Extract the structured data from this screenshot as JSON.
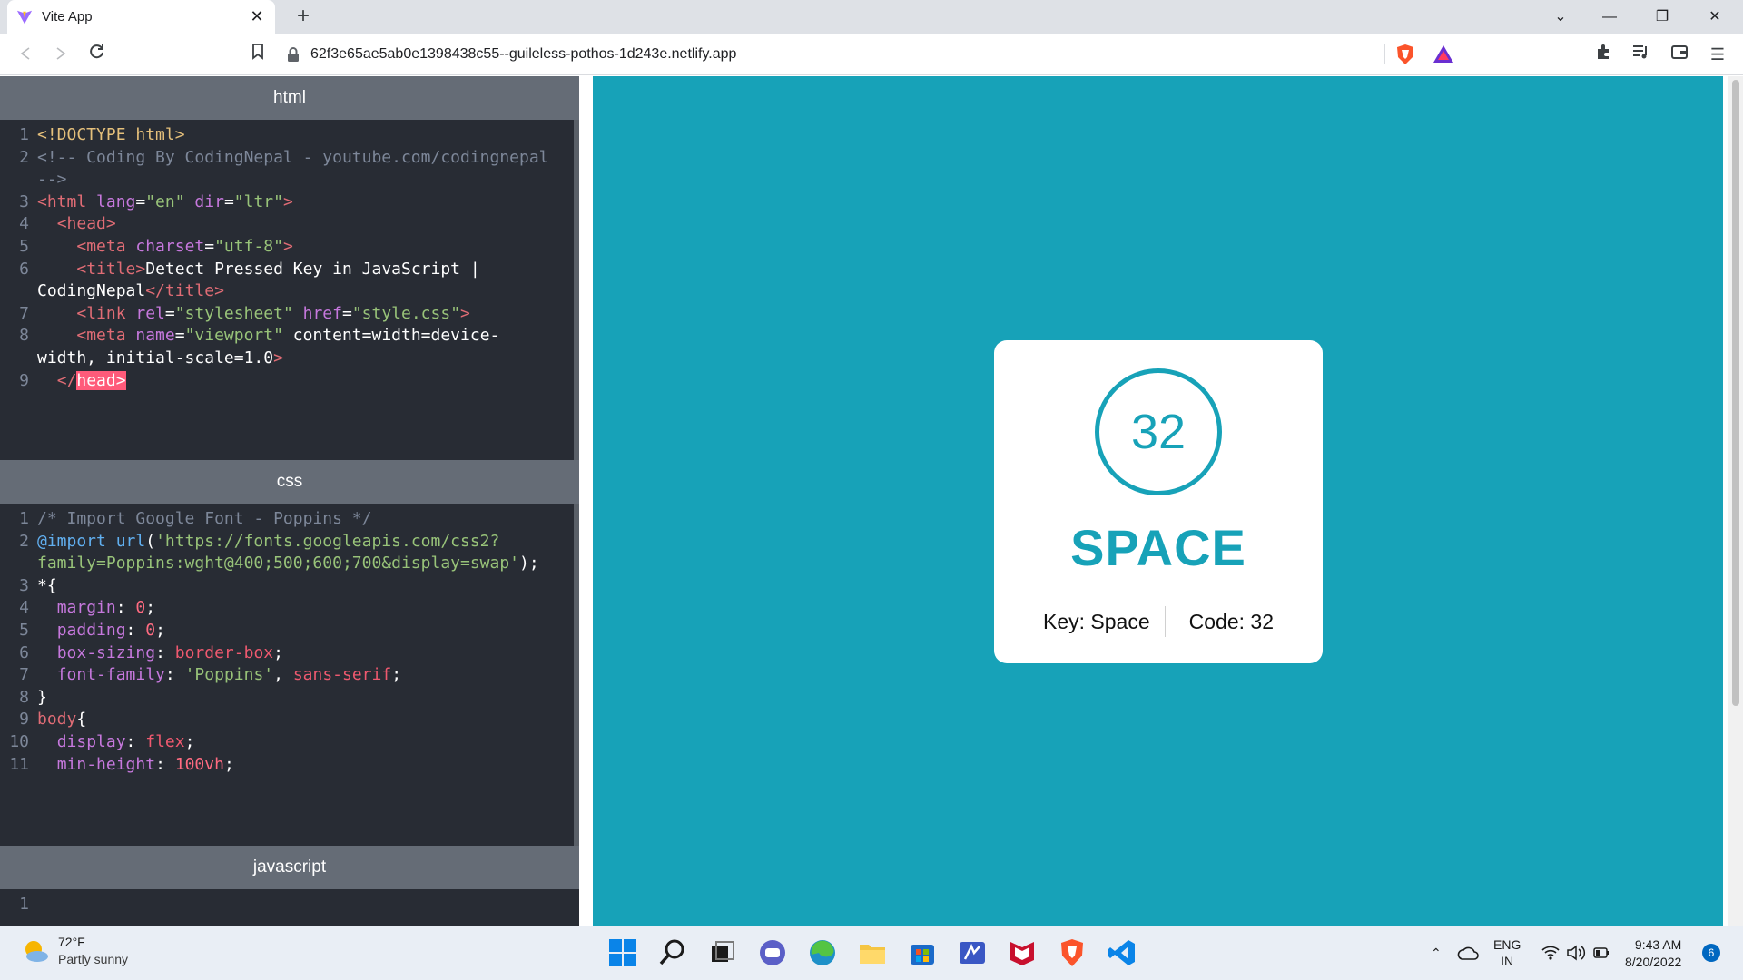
{
  "browser": {
    "tab_title": "Vite App",
    "url": "62f3e65ae5ab0e1398438c55--guileless-pothos-1d243e.netlify.app"
  },
  "editors": {
    "html_label": "html",
    "css_label": "css",
    "js_label": "javascript"
  },
  "html_lines": [
    {
      "n": "1",
      "text": "<!DOCTYPE html>"
    },
    {
      "n": "2",
      "text": "<!-- Coding By CodingNepal - youtube.com/codingnepal"
    },
    {
      "n": "",
      "text": "-->"
    },
    {
      "n": "3",
      "text": "<html lang=\"en\" dir=\"ltr\">"
    },
    {
      "n": "4",
      "text": "  <head>"
    },
    {
      "n": "5",
      "text": "    <meta charset=\"utf-8\">"
    },
    {
      "n": "6",
      "text": "    <title>Detect Pressed Key in JavaScript |"
    },
    {
      "n": "",
      "text": "CodingNepal</title>"
    },
    {
      "n": "7",
      "text": "    <link rel=\"stylesheet\" href=\"style.css\">"
    },
    {
      "n": "8",
      "text": "    <meta name=\"viewport\" content=\"width=device-"
    },
    {
      "n": "",
      "text": "width, initial-scale=1.0\">"
    },
    {
      "n": "9",
      "text": "  </head>"
    }
  ],
  "css_lines": [
    {
      "n": "1",
      "text": "/* Import Google Font - Poppins */"
    },
    {
      "n": "2",
      "text": "@import url('https://fonts.googleapis.com/css2?"
    },
    {
      "n": "",
      "text": "family=Poppins:wght@400;500;600;700&display=swap');"
    },
    {
      "n": "3",
      "text": "*{"
    },
    {
      "n": "4",
      "text": "  margin: 0;"
    },
    {
      "n": "5",
      "text": "  padding: 0;"
    },
    {
      "n": "6",
      "text": "  box-sizing: border-box;"
    },
    {
      "n": "7",
      "text": "  font-family: 'Poppins', sans-serif;"
    },
    {
      "n": "8",
      "text": "}"
    },
    {
      "n": "9",
      "text": "body{"
    },
    {
      "n": "10",
      "text": "  display: flex;"
    },
    {
      "n": "11",
      "text": "  min-height: 100vh;"
    }
  ],
  "js_lines": [
    {
      "n": "1",
      "text": ""
    }
  ],
  "preview": {
    "key_code": "32",
    "key_name": "SPACE",
    "key_label": "Key: Space",
    "code_label": "Code: 32"
  },
  "colors": {
    "accent": "#17a2b8",
    "editor_bg": "#282c34",
    "pane_header": "#656c76"
  },
  "taskbar": {
    "temperature": "72°F",
    "condition": "Partly sunny",
    "language": "ENG",
    "region": "IN",
    "time": "9:43 AM",
    "date": "8/20/2022",
    "notification_count": "6"
  }
}
